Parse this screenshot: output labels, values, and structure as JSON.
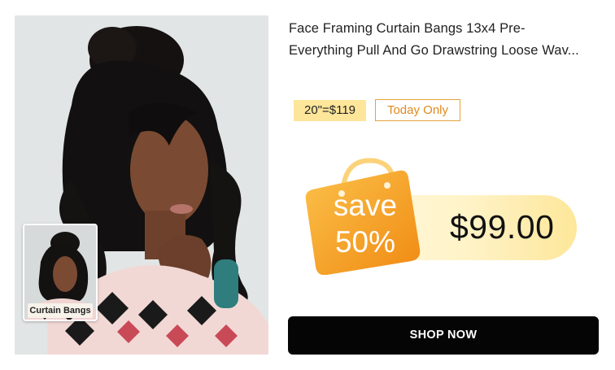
{
  "product": {
    "title_line1": "Face Framing Curtain Bangs 13x4 Pre-",
    "title_line2": "Everything Pull And Go Drawstring Loose Wav...",
    "image_alt": "Model wearing loose wave wig with curtain bangs",
    "thumbnail_label": "Curtain Bangs"
  },
  "pricing": {
    "original_tag": "20\"=$119",
    "badge": "Today Only",
    "discount_line1": "save",
    "discount_line2": "50%",
    "sale_price": "$99.00"
  },
  "cta": {
    "label": "SHOP NOW"
  },
  "colors": {
    "accent_orange": "#f59a1c",
    "tag_yellow": "#fde59a",
    "button_black": "#050505"
  }
}
